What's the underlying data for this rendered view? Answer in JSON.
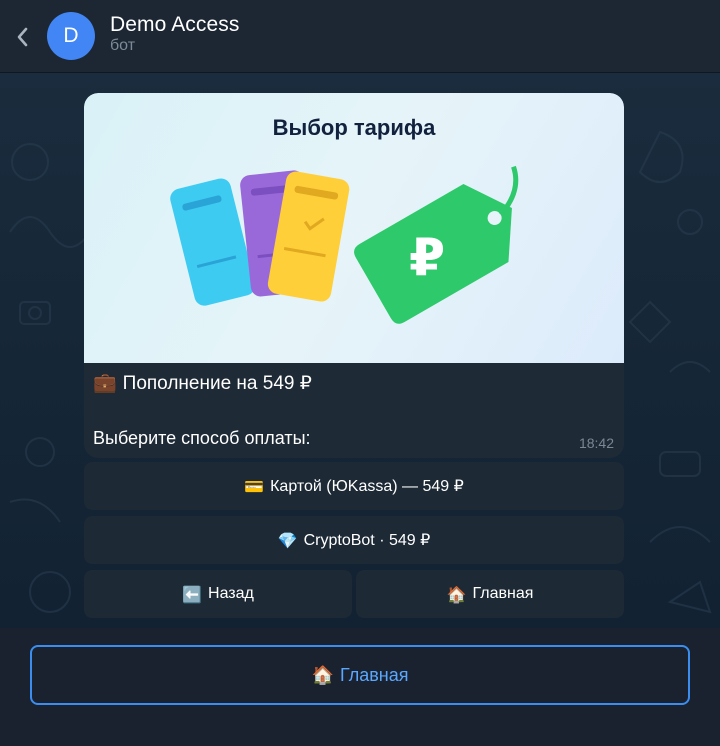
{
  "header": {
    "avatar_letter": "D",
    "title": "Demo Access",
    "subtitle": "бот"
  },
  "message": {
    "banner_title": "Выбор тарифа",
    "line1_icon": "💼",
    "line1_text": "Пополнение на 549 ₽",
    "line2_text": "Выберите способ оплаты:",
    "time": "18:42"
  },
  "inline_buttons": [
    {
      "icon": "💳",
      "label": "Картой (ЮKassa) — 549 ₽"
    },
    {
      "icon": "💎",
      "label": "CryptoBot · 549 ₽"
    },
    {
      "icon": "⬅️",
      "label": "Назад"
    },
    {
      "icon": "🏠",
      "label": "Главная"
    }
  ],
  "keyboard": {
    "icon": "🏠",
    "label": "Главная"
  },
  "colors": {
    "accent": "#3b8ef0",
    "avatar": "#4285f4",
    "price_tag": "#2ec96b"
  }
}
